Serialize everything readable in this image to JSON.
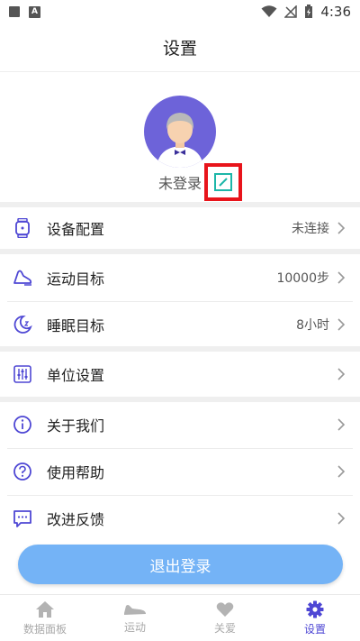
{
  "status_bar": {
    "time": "4:36"
  },
  "header": {
    "title": "设置"
  },
  "profile": {
    "login_status": "未登录"
  },
  "menu": [
    {
      "label": "设备配置",
      "value": "未连接",
      "icon": "watch-icon"
    },
    {
      "label": "运动目标",
      "value": "10000步",
      "icon": "shoe-icon"
    },
    {
      "label": "睡眠目标",
      "value": "8小时",
      "icon": "moon-icon"
    },
    {
      "label": "单位设置",
      "value": "",
      "icon": "sliders-icon"
    },
    {
      "label": "关于我们",
      "value": "",
      "icon": "info-icon"
    },
    {
      "label": "使用帮助",
      "value": "",
      "icon": "help-icon"
    },
    {
      "label": "改进反馈",
      "value": "",
      "icon": "chat-icon"
    }
  ],
  "logout_label": "退出登录",
  "tabs": [
    {
      "label": "数据面板",
      "icon": "home-icon",
      "active": false
    },
    {
      "label": "运动",
      "icon": "sneaker-icon",
      "active": false
    },
    {
      "label": "关爱",
      "icon": "heart-icon",
      "active": false
    },
    {
      "label": "设置",
      "icon": "gear-icon",
      "active": true
    }
  ],
  "colors": {
    "accent": "#4e47d4",
    "avatar_bg": "#6d63d9",
    "logout_button": "#74b3f6",
    "edit_icon": "#1cb6a8",
    "highlight_box": "#e8141b"
  }
}
